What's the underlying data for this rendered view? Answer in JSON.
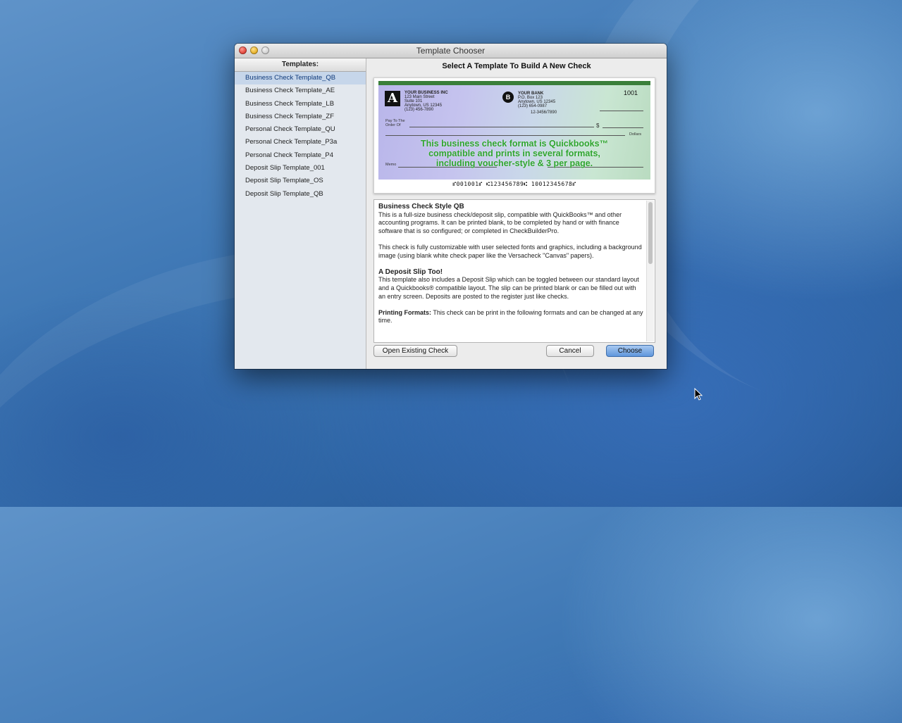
{
  "window": {
    "title": "Template Chooser"
  },
  "sidebar": {
    "header": "Templates:",
    "items": [
      {
        "label": "Business Check Template_QB",
        "selected": true
      },
      {
        "label": "Business Check Template_AE",
        "selected": false
      },
      {
        "label": "Business Check Template_LB",
        "selected": false
      },
      {
        "label": "Business Check Template_ZF",
        "selected": false
      },
      {
        "label": "Personal Check Template_QU",
        "selected": false
      },
      {
        "label": "Personal Check Template_P3a",
        "selected": false
      },
      {
        "label": "Personal Check Template_P4",
        "selected": false
      },
      {
        "label": "Deposit Slip Template_001",
        "selected": false
      },
      {
        "label": "Deposit Slip Template_OS",
        "selected": false
      },
      {
        "label": "Deposit Slip Template_QB",
        "selected": false
      }
    ]
  },
  "main": {
    "heading": "Select A Template To Build A New Check",
    "check_preview": {
      "logo_letter": "A",
      "business_name": "YOUR BUSINESS INC",
      "business_address": [
        "123 Main Street",
        "Suite 101",
        "Anytown, US 12345",
        "(123) 456-7890"
      ],
      "bank_logo": "B",
      "bank_name": "YOUR BANK",
      "bank_address": [
        "P.O. Box 123",
        "Anytown, US 12345",
        "(123) 654-0987"
      ],
      "routing_fraction": "12-3456/7890",
      "check_number": "1001",
      "pay_to_label": "Pay To The Order Of",
      "dollar_sign": "$",
      "dollars_label": "Dollars",
      "memo_label": "Memo",
      "promo_text": [
        "This business check format is Quickbooks™",
        "compatible and prints in several formats,",
        "including voucher-style & 3 per page."
      ],
      "micr_line": "⑈001001⑈ ⑆123456789⑆ 10012345678⑈"
    },
    "description": {
      "title": "Business Check Style QB",
      "para1": "This is a full-size business check/deposit slip, compatible with QuickBooks™ and other accounting programs. It can be printed blank, to be completed by hand or with finance software that is so configured; or completed in CheckBuilderPro.",
      "para2": "This check is fully customizable with user selected fonts and graphics, including a background image (using blank white check paper like the Versacheck \"Canvas\" papers).",
      "section2_title": "A Deposit Slip Too!",
      "para3": "This template also includes a Deposit Slip which can be toggled between our standard layout and a Quickbooks® compatible layout. The slip can be printed blank or can be filled out with an entry screen. Deposits are posted to the register just like checks.",
      "formats_label": "Printing Formats:",
      "formats_text": " This check can be print in the following formats and can be changed at any time."
    }
  },
  "buttons": {
    "open_existing": "Open Existing Check",
    "cancel": "Cancel",
    "choose": "Choose"
  },
  "colors": {
    "selection": "#c6d6ea",
    "primary_button": "#5f96dc",
    "promo_green": "#2fa52f"
  }
}
